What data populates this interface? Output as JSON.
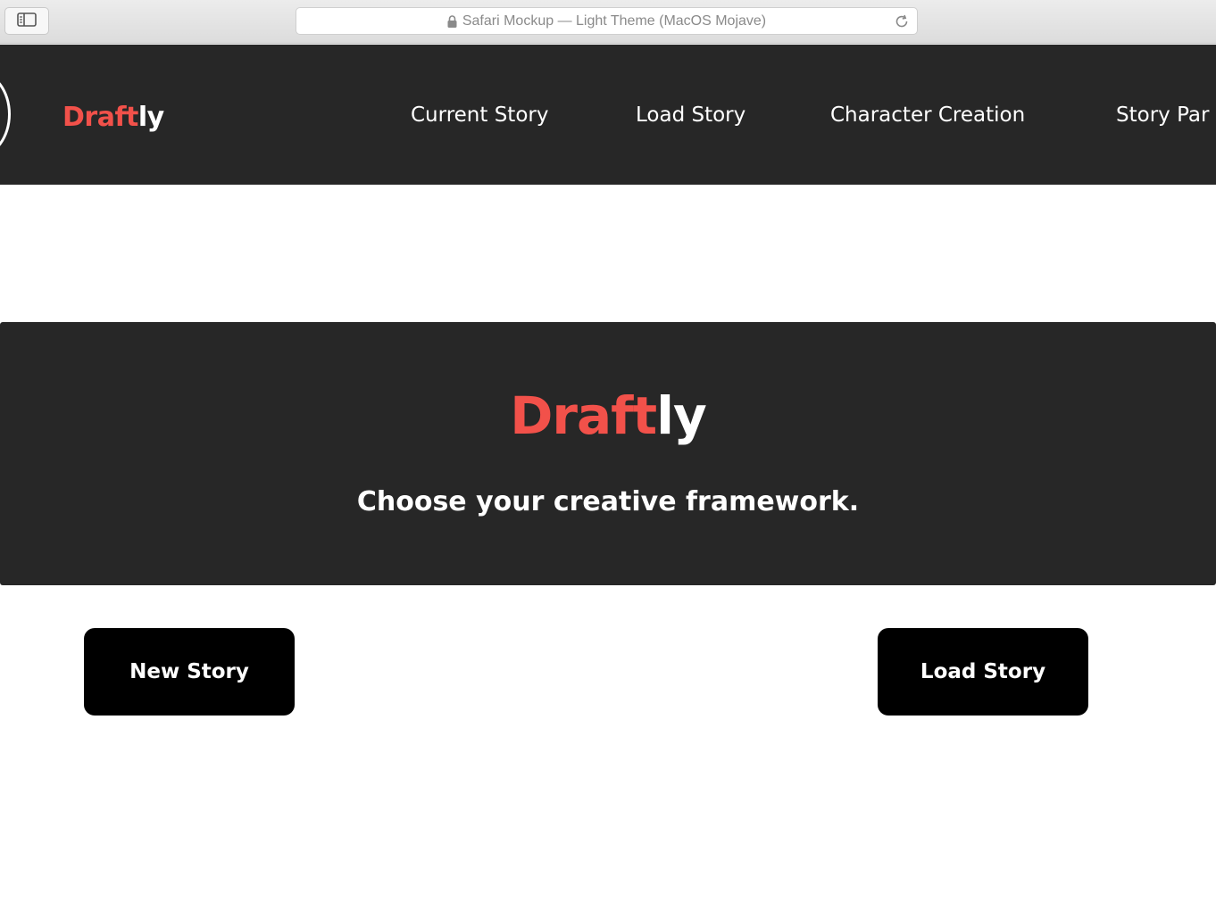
{
  "browser": {
    "address_text": "Safari Mockup — Light Theme (MacOS Mojave)",
    "icons": [
      "sidebar-toggle-icon",
      "lock-icon",
      "reload-icon"
    ]
  },
  "nav": {
    "brand_part1": "Draft",
    "brand_part2": "ly",
    "links": [
      "Current Story",
      "Load Story",
      "Character Creation",
      "Story Par"
    ]
  },
  "hero": {
    "title_part1": "Draft",
    "title_part2": "ly",
    "subtitle": "Choose your creative framework."
  },
  "actions": {
    "new_story": "New Story",
    "load_story": "Load Story"
  },
  "colors": {
    "accent": "#f2514a",
    "dark_background": "#272727",
    "button_background": "#000000",
    "text_light": "#ffffff"
  }
}
